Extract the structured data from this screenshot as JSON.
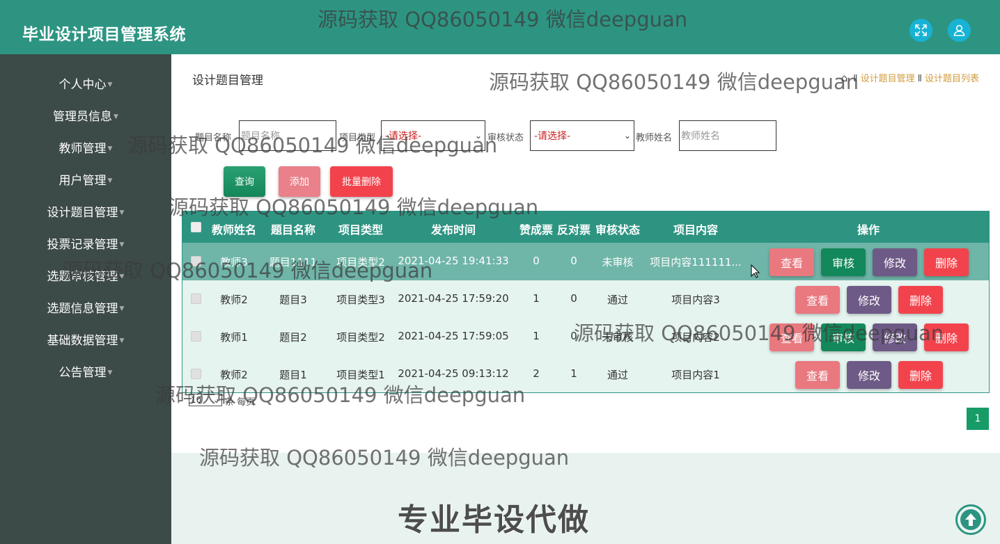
{
  "app": {
    "title": "毕业设计项目管理系统"
  },
  "header": {
    "fullscreen_icon": "expand-icon",
    "user_icon": "user-icon"
  },
  "sidebar": {
    "items": [
      {
        "label": "个人中心"
      },
      {
        "label": "管理员信息"
      },
      {
        "label": "教师管理"
      },
      {
        "label": "用户管理"
      },
      {
        "label": "设计题目管理"
      },
      {
        "label": "投票记录管理"
      },
      {
        "label": "选题审核管理"
      },
      {
        "label": "选题信息管理"
      },
      {
        "label": "基础数据管理"
      },
      {
        "label": "公告管理"
      }
    ]
  },
  "page": {
    "title": "设计题目管理",
    "breadcrumb": {
      "item1": "设计题目管理",
      "item2": "设计题目列表",
      "sep": "Ⅱ"
    }
  },
  "filters": {
    "title_label": "题目名称",
    "title_placeholder": "题目名称",
    "type_label": "项目类型",
    "type_value": "-请选择-",
    "status_label": "审核状态",
    "status_value": "-请选择-",
    "teacher_label": "教师姓名",
    "teacher_placeholder": "教师姓名"
  },
  "actions": {
    "query": "查询",
    "add": "添加",
    "batch_delete": "批量删除"
  },
  "table": {
    "headers": [
      "教师姓名",
      "题目名称",
      "项目类型",
      "发布时间",
      "赞成票",
      "反对票",
      "审核状态",
      "项目内容",
      "操作"
    ],
    "rows": [
      {
        "teacher": "教师3",
        "title": "题目1111",
        "type": "项目类型2",
        "time": "2021-04-25 19:41:33",
        "yes": "0",
        "no": "0",
        "status": "未审核",
        "content": "项目内容111111...",
        "highlighted": true,
        "buttons": [
          "查看",
          "审核",
          "修改",
          "删除"
        ]
      },
      {
        "teacher": "教师2",
        "title": "题目3",
        "type": "项目类型3",
        "time": "2021-04-25 17:59:20",
        "yes": "1",
        "no": "0",
        "status": "通过",
        "content": "项目内容3",
        "highlighted": false,
        "buttons": [
          "查看",
          "修改",
          "删除"
        ]
      },
      {
        "teacher": "教师1",
        "title": "题目2",
        "type": "项目类型2",
        "time": "2021-04-25 17:59:05",
        "yes": "1",
        "no": "0",
        "status": "未审核",
        "content": "项目内容2",
        "highlighted": false,
        "buttons": [
          "查看",
          "审核",
          "修改",
          "删除"
        ]
      },
      {
        "teacher": "教师2",
        "title": "题目1",
        "type": "项目类型1",
        "time": "2021-04-25 09:13:12",
        "yes": "2",
        "no": "1",
        "status": "通过",
        "content": "项目内容1",
        "highlighted": false,
        "buttons": [
          "查看",
          "修改",
          "删除"
        ]
      }
    ]
  },
  "pagination": {
    "page_size": "10",
    "per_page_text": "条 每页",
    "current_page": "1"
  },
  "footer": {
    "text": "专业毕设代做"
  },
  "watermark": {
    "text": "源码获取 QQ86050149 微信deepguan"
  },
  "colors": {
    "primary": "#2e9482",
    "sidebar": "#3c4a48",
    "view": "#e9787f",
    "audit": "#13885a",
    "edit": "#6e5a86",
    "delete": "#f2434c"
  }
}
